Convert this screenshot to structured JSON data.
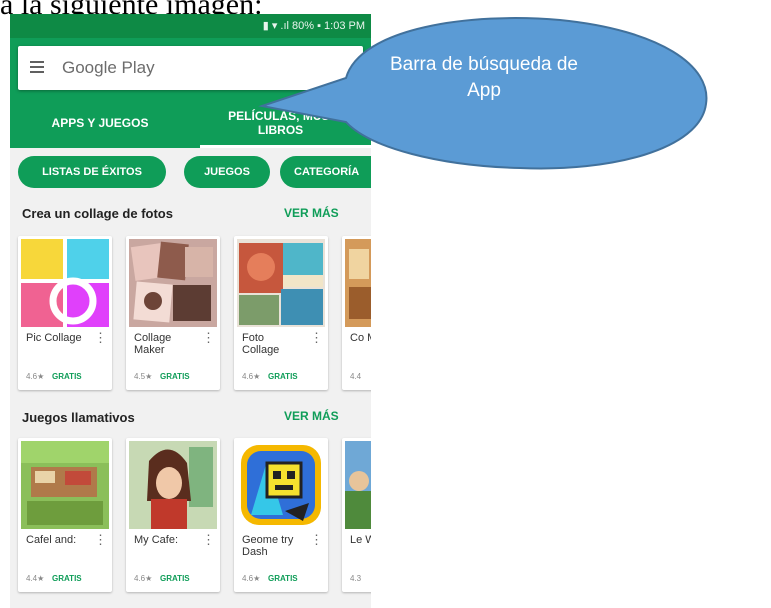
{
  "caption": "a la siguiente imagen:",
  "status_bar": {
    "text": "▮ ▾ .ıl 80% ▪ 1:03 PM"
  },
  "search": {
    "placeholder": "Google Play"
  },
  "tabs": [
    {
      "label": "APPS Y JUEGOS"
    },
    {
      "label": "PELÍCULAS, MÚSI LIBROS"
    }
  ],
  "chips": [
    {
      "label": "LISTAS DE ÉXITOS"
    },
    {
      "label": "JUEGOS"
    },
    {
      "label": "CATEGORÍA"
    }
  ],
  "sections": [
    {
      "title": "Crea un collage de fotos",
      "more": "VER MÁS",
      "apps": [
        {
          "name": "Pic Collage",
          "rating": "4.6★",
          "price": "GRATIS"
        },
        {
          "name": "Collage Maker",
          "rating": "4.5★",
          "price": "GRATIS"
        },
        {
          "name": "Foto Collage",
          "rating": "4.6★",
          "price": "GRATIS"
        },
        {
          "name": "Co Ma",
          "rating": "4.4",
          "price": ""
        }
      ]
    },
    {
      "title": "Juegos llamativos",
      "more": "VER MÁS",
      "apps": [
        {
          "name": "Cafel and:",
          "rating": "4.4★",
          "price": "GRATIS"
        },
        {
          "name": "My Cafe:",
          "rating": "4.6★",
          "price": "GRATIS"
        },
        {
          "name": "Geome try Dash",
          "rating": "4.6★",
          "price": "GRATIS"
        },
        {
          "name": "Le Wi",
          "rating": "4.3",
          "price": ""
        }
      ]
    }
  ],
  "callout": {
    "text": "Barra de búsqueda de App",
    "color": "#5b9bd5"
  },
  "colors": {
    "play_green": "#0f9d58",
    "status_green": "#0e8a45"
  },
  "icons": {
    "menu": "hamburger-menu-icon",
    "overflow": "more-vertical-icon"
  }
}
